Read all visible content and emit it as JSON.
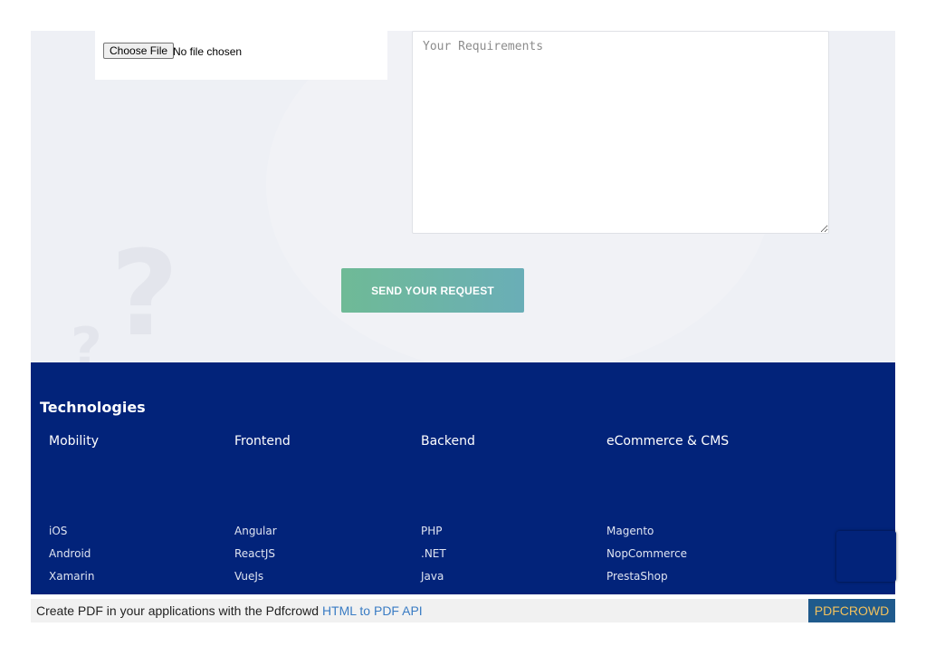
{
  "form": {
    "file_button_label": "Choose File",
    "file_status": "No file chosen",
    "requirements_placeholder": "Your Requirements",
    "submit_label": "SEND YOUR REQUEST"
  },
  "technologies": {
    "title": "Technologies",
    "columns": [
      {
        "heading": "Mobility",
        "items": [
          "iOS",
          "Android",
          "Xamarin"
        ]
      },
      {
        "heading": "Frontend",
        "items": [
          "Angular",
          "ReactJS",
          "VueJs"
        ]
      },
      {
        "heading": "Backend",
        "items": [
          "PHP",
          ".NET",
          "Java"
        ]
      },
      {
        "heading": "eCommerce & CMS",
        "items": [
          "Magento",
          "NopCommerce",
          "PrestaShop"
        ]
      }
    ]
  },
  "pdfcrowd": {
    "text": "Create PDF in your applications with the Pdfcrowd ",
    "link": "HTML to PDF API",
    "badge": "PDFCROWD"
  },
  "colors": {
    "footer_bg": "#02237a",
    "button_gradient_start": "#6fba96",
    "button_gradient_end": "#6aaeb7",
    "pdf_badge_bg": "#1f5a8c"
  }
}
